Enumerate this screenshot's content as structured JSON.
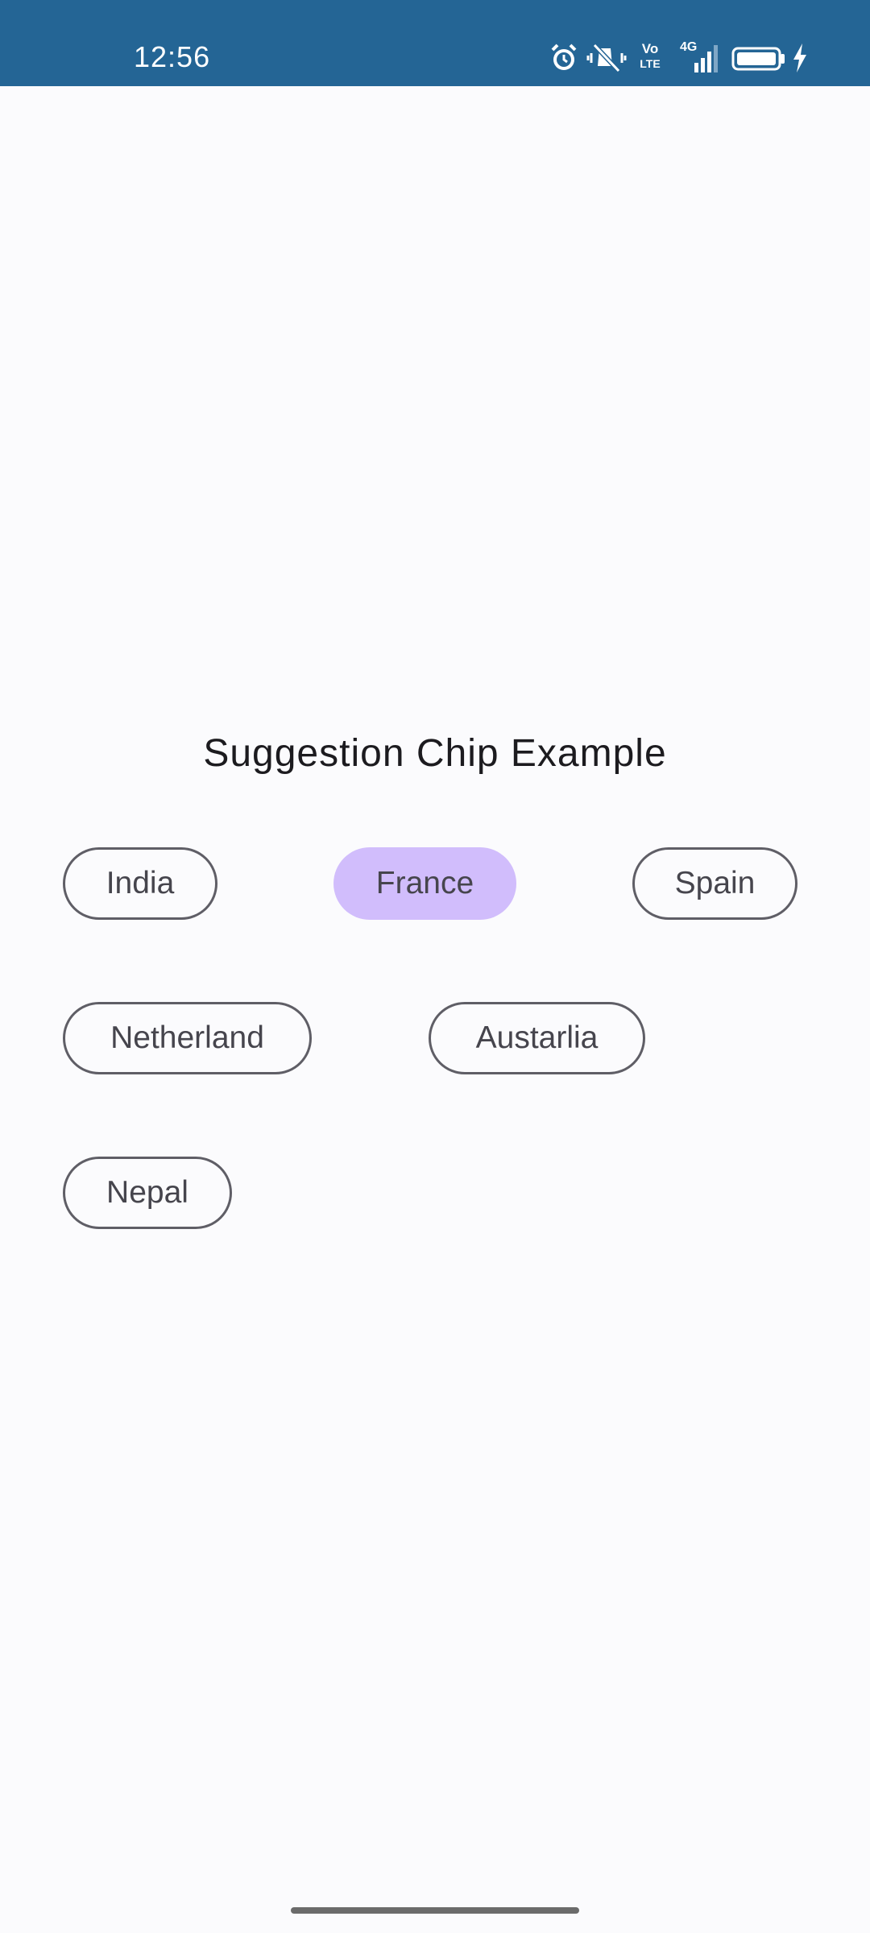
{
  "status_bar": {
    "time": "12:56",
    "icons": [
      "alarm-icon",
      "mute-icon",
      "volte-icon",
      "signal-4g-icon",
      "battery-icon",
      "charging-icon"
    ],
    "volte_top": "Vo",
    "volte_bottom": "LTE",
    "network_label": "4G",
    "background_color": "#246595"
  },
  "screen": {
    "title": "Suggestion Chip Example",
    "chips": [
      {
        "label": "India",
        "selected": false
      },
      {
        "label": "France",
        "selected": true
      },
      {
        "label": "Spain",
        "selected": false
      },
      {
        "label": "Netherland",
        "selected": false
      },
      {
        "label": "Austarlia",
        "selected": false
      },
      {
        "label": "Nepal",
        "selected": false
      }
    ],
    "selected_chip_color": "#d1bdfc",
    "chip_outline_color": "#5f5e66"
  }
}
